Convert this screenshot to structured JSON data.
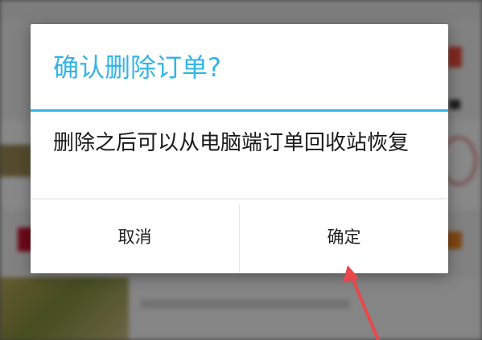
{
  "dialog": {
    "title": "确认删除订单?",
    "message": "删除之后可以从电脑端订单回收站恢复",
    "cancel_label": "取消",
    "confirm_label": "确定"
  },
  "colors": {
    "accent": "#33b5e5",
    "annotation_arrow": "#e8474b",
    "scrim": "rgba(0,0,0,0.45)"
  },
  "annotation": {
    "type": "arrow",
    "points_to": "confirm-button"
  }
}
